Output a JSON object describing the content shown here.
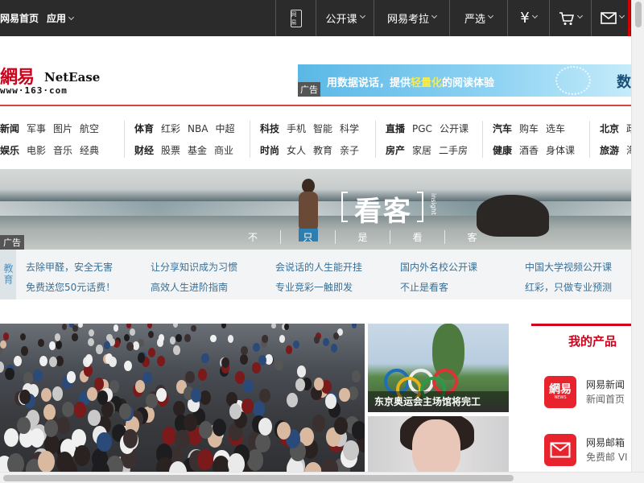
{
  "topbar": {
    "home_link": "网易首页",
    "apps_label": "应用",
    "phone_icon_text": "网易",
    "items": [
      {
        "label": "公开课"
      },
      {
        "label": "网易考拉"
      },
      {
        "label": "严选"
      },
      {
        "label": "¥"
      }
    ],
    "cart_icon": "cart-icon",
    "mail_icon": "mail-icon",
    "accent_color": "#d40000"
  },
  "logo": {
    "cn": "網易",
    "en": "NetEase",
    "url": "www·163·com"
  },
  "ad_banner": {
    "text_pre": "用数据说话，提供",
    "text_highlight": "轻量化",
    "text_post": "的阅读体验",
    "tail": "数",
    "tag": "广告"
  },
  "nav": {
    "groups": [
      {
        "rows": [
          [
            "新闻",
            "军事",
            "图片",
            "航空"
          ],
          [
            "娱乐",
            "电影",
            "音乐",
            "经典"
          ]
        ]
      },
      {
        "rows": [
          [
            "体育",
            "红彩",
            "NBA",
            "中超"
          ],
          [
            "财经",
            "股票",
            "基金",
            "商业"
          ]
        ]
      },
      {
        "rows": [
          [
            "科技",
            "手机",
            "智能",
            "科学"
          ],
          [
            "时尚",
            "女人",
            "教育",
            "亲子"
          ]
        ]
      },
      {
        "rows": [
          [
            "直播",
            "PGC",
            "公开课"
          ],
          [
            "房产",
            "家居",
            "二手房"
          ]
        ]
      },
      {
        "rows": [
          [
            "汽车",
            "购车",
            "选车"
          ],
          [
            "健康",
            "酒香",
            "身体课"
          ]
        ]
      },
      {
        "rows": [
          [
            "北京",
            "政"
          ],
          [
            "旅游",
            "海"
          ]
        ]
      }
    ]
  },
  "hero": {
    "brand": "看客",
    "brand_small": "insight",
    "slogan": [
      "不",
      "只",
      "是",
      "看",
      "客"
    ],
    "tag": "广告"
  },
  "edu": {
    "label": "教育",
    "columns": [
      [
        "去除甲醛，安全无害",
        "免费送您50元话费！"
      ],
      [
        "让分享知识成为习惯",
        "高效人生进阶指南"
      ],
      [
        "会说话的人生能开挂",
        "专业竞彩一触即发"
      ],
      [
        "国内外名校公开课",
        "不止是看客"
      ],
      [
        "中国大学视频公开课",
        "红彩，只做专业预测"
      ]
    ]
  },
  "stories": {
    "photo2_caption": "东京奥运会主场馆将完工"
  },
  "products": {
    "title": "我的产品",
    "items": [
      {
        "name": "网易新闻",
        "sub": "新闻首页",
        "icon": "netease-news-icon",
        "icon_text": "網易",
        "icon_sub": "NEWS"
      },
      {
        "name": "网易邮箱",
        "sub": "免费邮  VI",
        "icon": "mail-icon"
      }
    ]
  }
}
